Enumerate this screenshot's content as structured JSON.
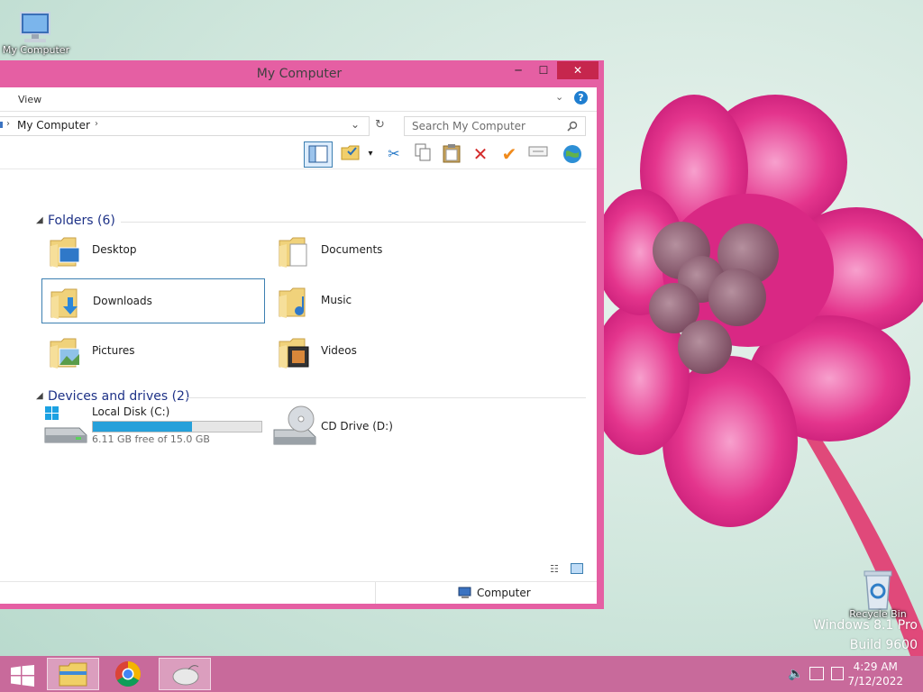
{
  "desktop": {
    "icons": [
      {
        "name": "my-computer",
        "label": "My Computer"
      },
      {
        "name": "recycle-bin",
        "label": "Recycle Bin"
      }
    ],
    "watermark_line1": "Windows 8.1 Pro",
    "watermark_line2": "Build 9600"
  },
  "window": {
    "title": "My Computer",
    "minimize_glyph": "─",
    "maximize_glyph": "☐",
    "close_glyph": "✕",
    "ribbon": {
      "view_label": "View",
      "help_glyph": "?"
    },
    "address": {
      "path_label": "My Computer",
      "search_placeholder": "Search My Computer"
    },
    "groups": {
      "folders_header": "Folders (6)",
      "folders": [
        {
          "label": "Desktop"
        },
        {
          "label": "Documents"
        },
        {
          "label": "Downloads"
        },
        {
          "label": "Music"
        },
        {
          "label": "Pictures"
        },
        {
          "label": "Videos"
        }
      ],
      "devices_header": "Devices and drives (2)",
      "local_disk": {
        "label": "Local Disk (C:)",
        "free_text": "6.11 GB free of 15.0 GB",
        "used_fraction": 0.59
      },
      "cd_drive": {
        "label": "CD Drive (D:)"
      }
    },
    "status": {
      "location": "Computer"
    }
  },
  "taskbar": {
    "time": "4:29 AM",
    "date": "7/12/2022"
  },
  "colors": {
    "window_frame": "#e55fa3",
    "close_button": "#c6264d",
    "taskbar": "#c86a9b",
    "group_header": "#1e3287",
    "progress": "#26a0da"
  }
}
